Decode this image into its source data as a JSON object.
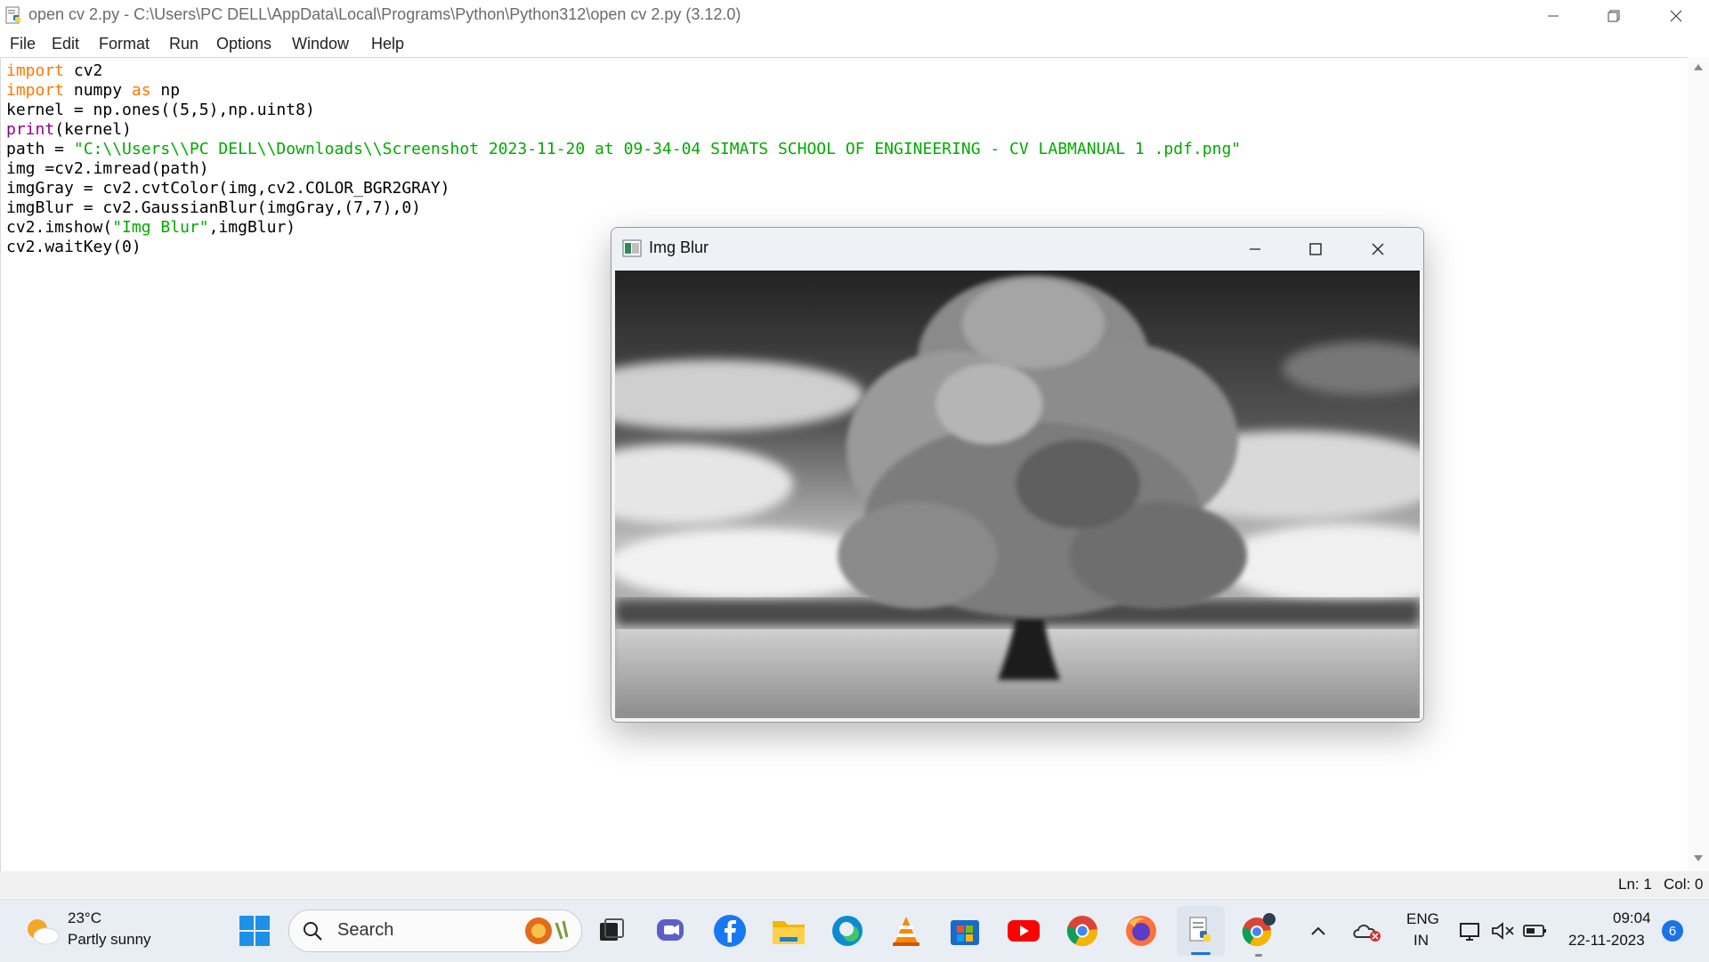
{
  "window": {
    "title": "open cv 2.py - C:\\Users\\PC DELL\\AppData\\Local\\Programs\\Python\\Python312\\open cv 2.py (3.12.0)"
  },
  "menu": {
    "items": [
      "File",
      "Edit",
      "Format",
      "Run",
      "Options",
      "Window",
      "Help"
    ]
  },
  "code": {
    "line1_kw": "import",
    "line1_rest": " cv2",
    "line2_kw": "import",
    "line2_mid": " numpy ",
    "line2_as": "as",
    "line2_rest": " np",
    "line3": "kernel = np.ones((5,5),np.uint8)",
    "line4_bi": "print",
    "line4_rest": "(kernel)",
    "line5_pre": "path = ",
    "line5_str": "\"C:\\\\Users\\\\PC DELL\\\\Downloads\\\\Screenshot 2023-11-20 at 09-34-04 SIMATS SCHOOL OF ENGINEERING - CV LABMANUAL 1 .pdf.png\"",
    "line6": "img =cv2.imread(path)",
    "line7": "imgGray = cv2.cvtColor(img,cv2.COLOR_BGR2GRAY)",
    "line8": "imgBlur = cv2.GaussianBlur(imgGray,(7,7),0)",
    "line9_pre": "cv2.imshow(",
    "line9_str": "\"Img Blur\"",
    "line9_rest": ",imgBlur)",
    "line10": "cv2.waitKey(0)"
  },
  "status": {
    "ln": "Ln: 1",
    "col": "Col: 0"
  },
  "cv_window": {
    "title": "Img Blur",
    "image_description_icon": "blurred-grayscale-tree-photo"
  },
  "taskbar": {
    "weather_temp": "23°C",
    "weather_desc": "Partly sunny",
    "search_placeholder": "Search",
    "language_line1": "ENG",
    "language_line2": "IN",
    "time": "09:04",
    "date": "22-11-2023",
    "notification_count": "6"
  },
  "colors": {
    "keyword": "#ff7700",
    "builtin": "#900090",
    "string": "#00aa00",
    "taskbar": "#e9eef5"
  }
}
